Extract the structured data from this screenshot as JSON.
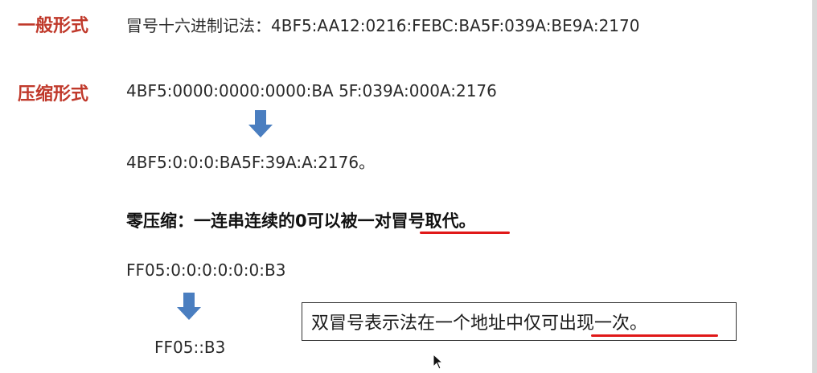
{
  "general": {
    "heading": "一般形式",
    "description": "冒号十六进制记法：4BF5:AA12:0216:FEBC:BA5F:039A:BE9A:2170"
  },
  "compressed": {
    "heading": "压缩形式",
    "original": "4BF5:0000:0000:0000:BA 5F:039A:000A:2176",
    "result": "4BF5:0:0:0:BA5F:39A:A:2176。"
  },
  "zero_compression": {
    "rule": "零压缩：一连串连续的0可以被一对冒号取代。",
    "example": "FF05:0:0:0:0:0:0:B3",
    "result": "FF05::B3"
  },
  "note": {
    "text": "双冒号表示法在一个地址中仅可出现一次。"
  },
  "colors": {
    "heading": "#c0392b",
    "arrow": "#4a7ec0",
    "underline": "#e01818"
  }
}
